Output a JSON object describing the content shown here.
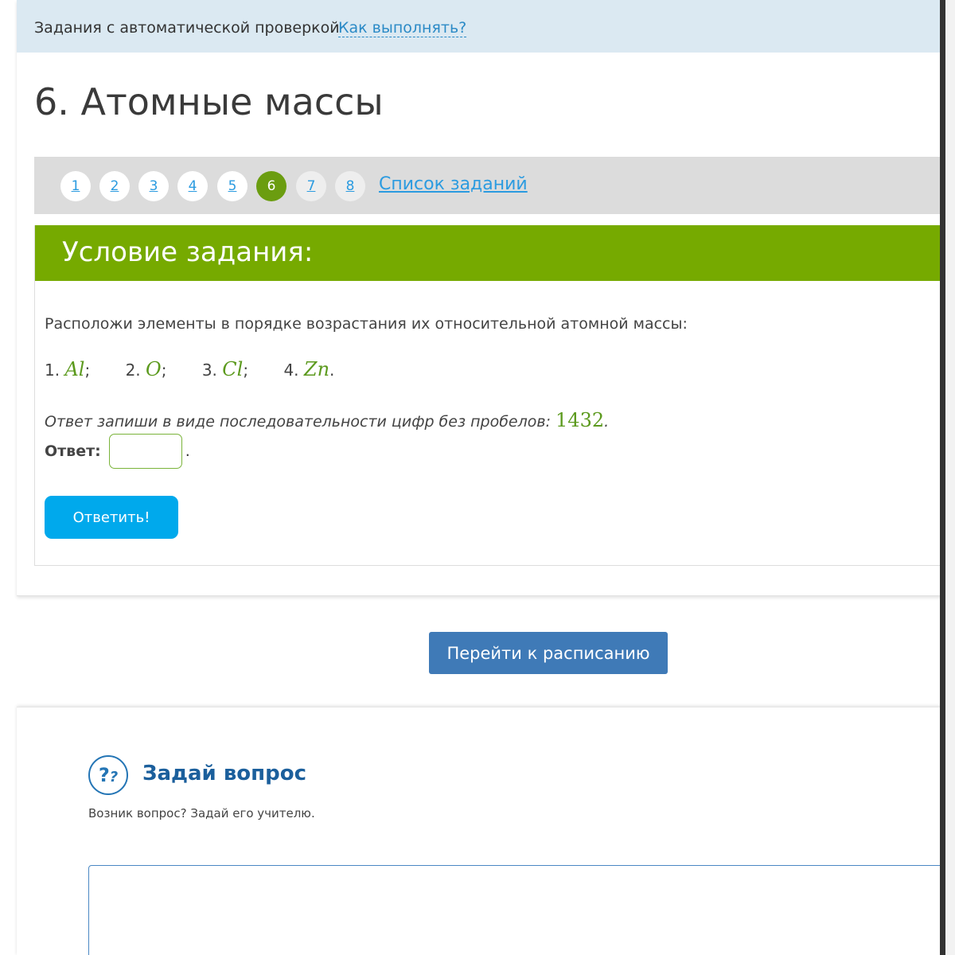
{
  "topbar": {
    "crumb": "Задания с автоматической проверкой",
    "howto_link": "Как выполнять?"
  },
  "title": "6. Атомные массы",
  "pager": {
    "pages": [
      {
        "label": "1",
        "state": "link"
      },
      {
        "label": "2",
        "state": "link"
      },
      {
        "label": "3",
        "state": "link"
      },
      {
        "label": "4",
        "state": "link"
      },
      {
        "label": "5",
        "state": "link"
      },
      {
        "label": "6",
        "state": "active"
      },
      {
        "label": "7",
        "state": "inactive"
      },
      {
        "label": "8",
        "state": "inactive"
      }
    ],
    "task_list_link": "Список заданий"
  },
  "task": {
    "header": "Условие задания:",
    "statement": "Расположи элементы в порядке возрастания их относительной атомной массы:",
    "elements": [
      {
        "num": "1.",
        "symbol": "Al",
        "sep": ";"
      },
      {
        "num": "2.",
        "symbol": "O",
        "sep": ";"
      },
      {
        "num": "3.",
        "symbol": "Cl",
        "sep": ";"
      },
      {
        "num": "4.",
        "symbol": "Zn",
        "sep": "."
      }
    ],
    "hint_text": "Ответ запиши в виде последовательности цифр без пробелов: ",
    "hint_example": "1432",
    "hint_end": ".",
    "answer_label": "Ответ:",
    "answer_value": "",
    "answer_end": ".",
    "submit_label": "Ответить!"
  },
  "schedule_button": "Перейти к расписанию",
  "ask": {
    "icon": "question-icon",
    "icon_glyph": "?",
    "icon_glyph_small": "?",
    "title": "Задай вопрос",
    "subtitle": "Возник вопрос? Задай его учителю.",
    "textarea_value": ""
  },
  "colors": {
    "topbar_bg": "#dbe9f2",
    "pager_bg": "#dcdcdc",
    "active_page": "#6b9d10",
    "task_header": "#76aa00",
    "submit": "#00a9ec",
    "schedule": "#3f7ab7",
    "ask_title": "#1b5f9c"
  }
}
